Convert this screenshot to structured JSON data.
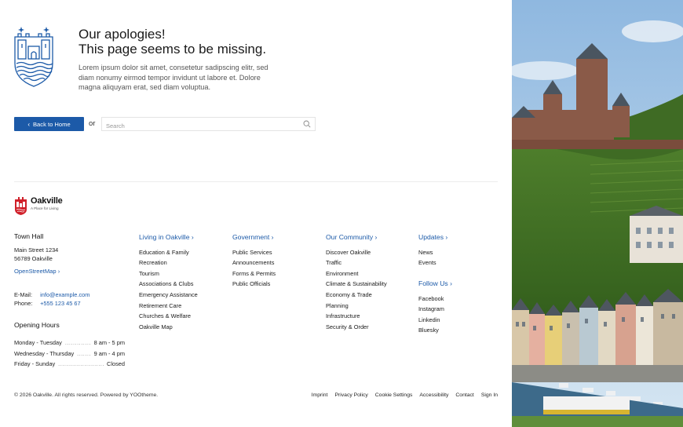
{
  "error": {
    "title_line1": "Our apologies!",
    "title_line2": "This page seems to be missing.",
    "lead": "Lorem ipsum dolor sit amet, consetetur sadipscing elitr, sed diam nonumy eirmod tempor invidunt ut labore et. Dolore magna aliquyam erat, sed diam voluptua.",
    "back_label": "Back to Home",
    "or_label": "or",
    "search_placeholder": "Search"
  },
  "brand": {
    "name": "Oakville",
    "tagline": "A Place for Living"
  },
  "townhall": {
    "heading": "Town Hall",
    "street": "Main Street 1234",
    "city": "56789 Oakville",
    "map_link": "OpenStreetMap",
    "email_label": "E-Mail:",
    "email": "info@example.com",
    "phone_label": "Phone:",
    "phone": "+555 123 45 67"
  },
  "hours": {
    "heading": "Opening Hours",
    "rows": [
      {
        "day": "Monday - Tuesday",
        "time": "8 am - 5 pm"
      },
      {
        "day": "Wednesday - Thursday",
        "time": "9 am - 4 pm"
      },
      {
        "day": "Friday - Sunday",
        "time": "Closed"
      }
    ]
  },
  "nav": {
    "living": {
      "heading": "Living in Oakville",
      "items": [
        "Education & Family",
        "Recreation",
        "Tourism",
        "Associations & Clubs",
        "Emergency Assistance",
        "Retirement Care",
        "Churches & Welfare",
        "Oakville Map"
      ]
    },
    "government": {
      "heading": "Government",
      "items": [
        "Public Services",
        "Announcements",
        "Forms & Permits",
        "Public Officials"
      ]
    },
    "community": {
      "heading": "Our Community",
      "items": [
        "Discover Oakville",
        "Traffic",
        "Environment",
        "Climate & Sustainability",
        "Economy & Trade",
        "Planning",
        "Infrastructure",
        "Security & Order"
      ]
    },
    "updates": {
      "heading": "Updates",
      "items": [
        "News",
        "Events"
      ]
    },
    "follow": {
      "heading": "Follow Us",
      "items": [
        "Facebook",
        "Instagram",
        "Linkedin",
        "Bluesky"
      ]
    }
  },
  "footer": {
    "copyright": "© 2026 Oakville. All rights reserved. Powered by YOOtheme.",
    "links": [
      "Imprint",
      "Privacy Policy",
      "Cookie Settings",
      "Accessibility",
      "Contact",
      "Sign In"
    ]
  },
  "colors": {
    "accent": "#1c5aa8",
    "logo_red": "#d0202a"
  }
}
